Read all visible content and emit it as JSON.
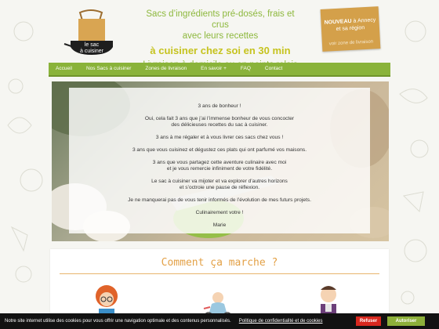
{
  "header": {
    "logo_line1": "le sac",
    "logo_line2": "à cuisiner",
    "tagline_1": "Sacs d’ingrédients pré-dosés, frais et crus",
    "tagline_2": "avec leurs recettes",
    "tagline_3": "à cuisiner chez soi en 30 min",
    "tagline_4": "Livraison à domicile ou en points relais"
  },
  "promo": {
    "new_label": "NOUVEAU",
    "line1_rest": " à Annecy",
    "line2": "et sa région",
    "link": "voir zone de livraison"
  },
  "nav": {
    "items": [
      "Accueil",
      "Nos Sacs à cuisiner",
      "Zones de livraison",
      "En savoir +",
      "FAQ",
      "Contact"
    ]
  },
  "message": {
    "p1": "3 ans de bonheur !",
    "p2a": "Oui, cela fait 3 ans que j’ai l’immense bonheur de vous concocter",
    "p2b": "des délicieuses recettes du sac à cuisiner.",
    "p3": "3 ans à me régaler et à vous livrer ces sacs chez vous !",
    "p4": "3 ans que vous cuisinez et dégustez ces plats qui ont parfumé vos maisons.",
    "p5a": "3 ans que vous partagez cette aventure culinaire avec moi",
    "p5b": "et je vous remercie infiniment de votre fidélité.",
    "p6a": "Le sac à cuisiner va mijoter et va explorer d’autres horizons",
    "p6b": "et s’octroie une pause de réflexion.",
    "p7": "Je ne manquerai pas de vous tenir informés de l’évolution de mes futurs projets.",
    "p8": "Culinairement votre !",
    "p9": "Marie"
  },
  "how": {
    "title": "Comment ça marche ?"
  },
  "cookie": {
    "text": "Notre site internet utilise des cookies pour vous offrir une navigation optimale et des contenus personnalisés.",
    "link": "Politique de confidentialité et de cookies",
    "refuse": "Refuser",
    "accept": "Autoriser"
  },
  "colors": {
    "green": "#8ab33a",
    "yellow": "#c6c31f",
    "orange": "#e3a147",
    "promo": "#d4a04a",
    "refuse": "#d8281f"
  }
}
